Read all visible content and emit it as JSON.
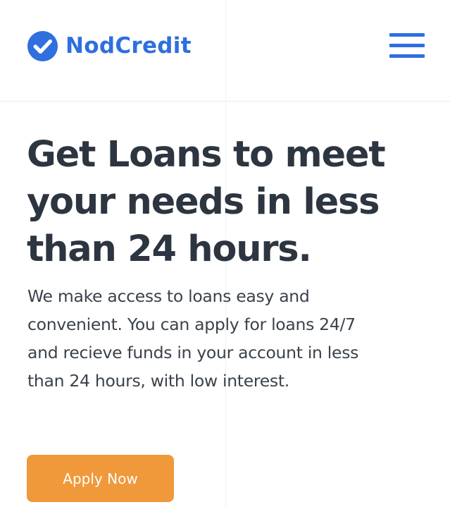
{
  "brand": {
    "name": "NodCredit",
    "logo_icon": "check-circle-icon",
    "color": "#2f6fde"
  },
  "header": {
    "menu_icon": "hamburger-menu-icon"
  },
  "hero": {
    "title_line1": "Get Loans to meet",
    "title_line2": "your needs in less",
    "title_line3": "than 24 hours.",
    "text_line1": "We make access to loans easy and",
    "text_line2": "convenient. You can apply for loans 24/7",
    "text_line3": "and recieve funds in your account in less",
    "text_line4": "than 24 hours, with low interest.",
    "cta_label": "Apply Now",
    "cta_color": "#f0993a",
    "title_color": "#2c3540"
  }
}
